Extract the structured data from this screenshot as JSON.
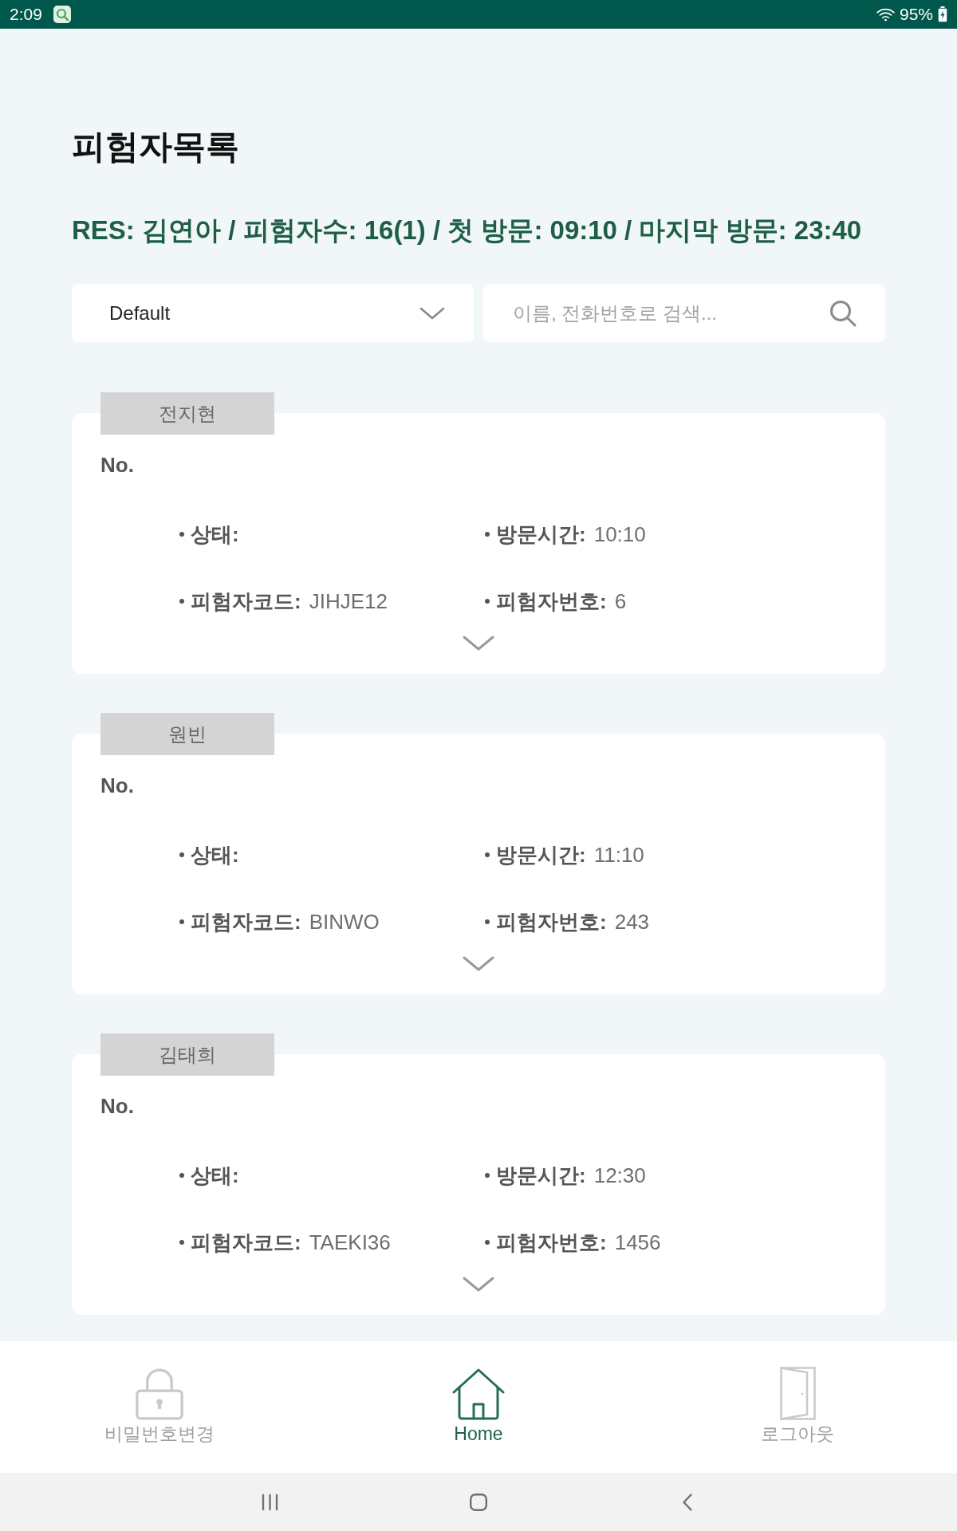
{
  "status_bar": {
    "time": "2:09",
    "battery": "95%"
  },
  "header": {
    "title": "피험자목록",
    "summary": "RES: 김연아 / 피험자수: 16(1) / 첫 방문: 09:10 / 마지막 방문: 23:40"
  },
  "filters": {
    "sort": {
      "value": "Default"
    },
    "search": {
      "placeholder": "이름, 전화번호로 검색..."
    }
  },
  "subjects": [
    {
      "name": "전지현",
      "number_label": "No.",
      "expanded": false,
      "fields": [
        {
          "label": "상태:"
        },
        {
          "label": "방문시간:",
          "value": "10:10"
        },
        {
          "label": "피험자코드:",
          "value": "JIHJE12"
        },
        {
          "label": "피험자번호:",
          "value": "6"
        }
      ]
    },
    {
      "name": "원빈",
      "number_label": "No.",
      "expanded": false,
      "fields": [
        {
          "label": "상태:"
        },
        {
          "label": "방문시간:",
          "value": "11:10"
        },
        {
          "label": "피험자코드:",
          "value": "BINWO"
        },
        {
          "label": "피험자번호:",
          "value": "243"
        }
      ]
    },
    {
      "name": "김태희",
      "number_label": "No.",
      "expanded": false,
      "fields": [
        {
          "label": "상태:"
        },
        {
          "label": "방문시간:",
          "value": "12:30"
        },
        {
          "label": "피험자코드:",
          "value": "TAEKI36"
        },
        {
          "label": "피험자번호:",
          "value": "1456"
        }
      ]
    }
  ],
  "bottom_nav": [
    {
      "kind": "lock",
      "label": "비밀번호변경",
      "selected": false
    },
    {
      "kind": "home",
      "label": "Home",
      "selected": true
    },
    {
      "kind": "door",
      "label": "로그아웃",
      "selected": false
    }
  ]
}
